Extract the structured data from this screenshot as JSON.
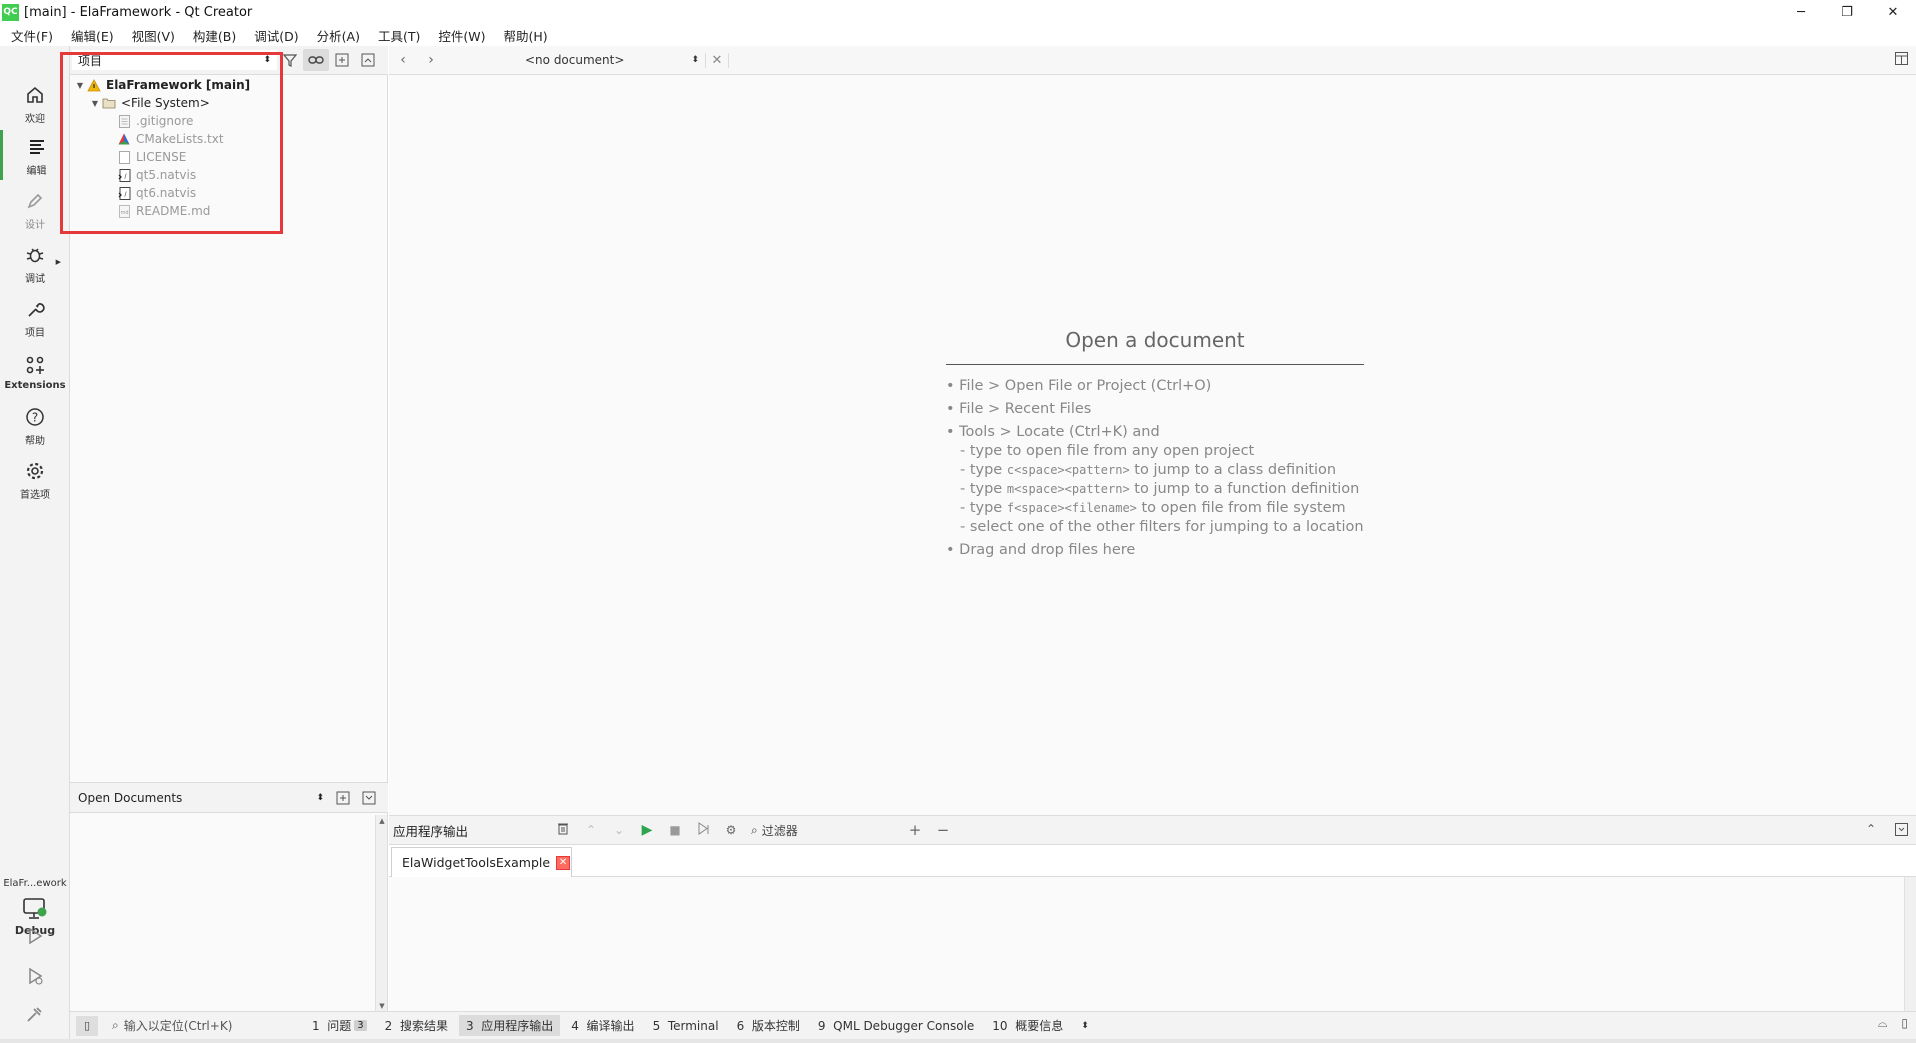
{
  "window": {
    "logo_text": "QC",
    "title": "[main] - ElaFramework - Qt Creator",
    "minimize": "─",
    "restore": "❐",
    "close": "✕"
  },
  "menu": [
    "文件(F)",
    "编辑(E)",
    "视图(V)",
    "构建(B)",
    "调试(D)",
    "分析(A)",
    "工具(T)",
    "控件(W)",
    "帮助(H)"
  ],
  "modes": [
    {
      "label": "欢迎",
      "icon": "home-icon"
    },
    {
      "label": "编辑",
      "icon": "edit-lines-icon",
      "active": true
    },
    {
      "label": "设计",
      "icon": "pen-icon",
      "dim": true
    },
    {
      "label": "调试",
      "icon": "bug-icon"
    },
    {
      "label": "项目",
      "icon": "wrench-icon"
    },
    {
      "label": "Extensions",
      "icon": "extensions-icon"
    },
    {
      "label": "帮助",
      "icon": "help-icon"
    },
    {
      "label": "首选项",
      "icon": "gear-icon"
    }
  ],
  "kit": {
    "project_label": "ElaFr...ework",
    "build_label": "Debug"
  },
  "project_panel": {
    "combo": "项目",
    "tree": [
      {
        "name": "ElaFramework [main]",
        "level": 0,
        "expanded": true,
        "style": "bold",
        "icon": "warning-icon"
      },
      {
        "name": "<File System>",
        "level": 1,
        "expanded": true,
        "style": "normal",
        "icon": "folder-icon"
      },
      {
        "name": ".gitignore",
        "level": 2,
        "style": "gray",
        "icon": "file-icon"
      },
      {
        "name": "CMakeLists.txt",
        "level": 2,
        "style": "gray",
        "icon": "cmake-icon"
      },
      {
        "name": "LICENSE",
        "level": 2,
        "style": "gray",
        "icon": "file-icon"
      },
      {
        "name": "qt5.natvis",
        "level": 2,
        "style": "gray",
        "icon": "natvis-icon"
      },
      {
        "name": "qt6.natvis",
        "level": 2,
        "style": "gray",
        "icon": "natvis-icon"
      },
      {
        "name": "README.md",
        "level": 2,
        "style": "gray",
        "icon": "markdown-icon"
      }
    ]
  },
  "open_documents": {
    "combo": "Open Documents"
  },
  "editor": {
    "doc_combo": "<no document>",
    "title": "Open a document",
    "hints": [
      "• File > Open File or Project (Ctrl+O)",
      "• File > Recent Files",
      "• Tools > Locate (Ctrl+K) and"
    ],
    "sub_hints": [
      {
        "pre": "- type to open file from any open project",
        "code": "",
        "post": ""
      },
      {
        "pre": "- type ",
        "code": "c<space><pattern>",
        "post": " to jump to a class definition"
      },
      {
        "pre": "- type ",
        "code": "m<space><pattern>",
        "post": " to jump to a function definition"
      },
      {
        "pre": "- type ",
        "code": "f<space><filename>",
        "post": " to open file from file system"
      },
      {
        "pre": "- select one of the other filters for jumping to a location",
        "code": "",
        "post": ""
      }
    ],
    "drag_hint": "• Drag and drop files here"
  },
  "output": {
    "title": "应用程序输出",
    "filter_placeholder": "过滤器",
    "tab_label": "ElaWidgetToolsExample"
  },
  "statusbar": {
    "locator_placeholder": "输入以定位(Ctrl+K)",
    "tabs": [
      {
        "num": "1",
        "label": "问题",
        "badge": "3"
      },
      {
        "num": "2",
        "label": "搜索结果"
      },
      {
        "num": "3",
        "label": "应用程序输出",
        "active": true
      },
      {
        "num": "4",
        "label": "编译输出"
      },
      {
        "num": "5",
        "label": "Terminal"
      },
      {
        "num": "6",
        "label": "版本控制"
      },
      {
        "num": "9",
        "label": "QML Debugger Console"
      },
      {
        "num": "10",
        "label": "概要信息"
      }
    ]
  },
  "colors": {
    "accent_green": "#3fa34d",
    "highlight_red": "#e5383b",
    "warning_yellow": "#f2b705"
  }
}
